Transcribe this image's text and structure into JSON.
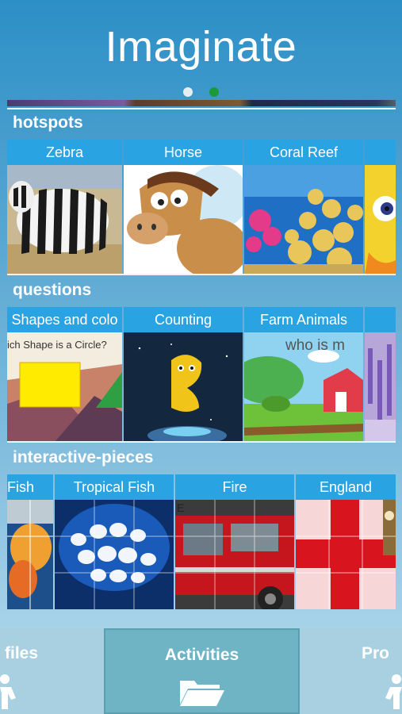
{
  "app": {
    "title": "Imaginate"
  },
  "pager": {
    "count": 2,
    "active_index": 1,
    "active_color": "#1b9a3c"
  },
  "sections": [
    {
      "label": "hotspots",
      "tiles": [
        "Zebra",
        "Horse",
        "Coral Reef",
        ""
      ]
    },
    {
      "label": "questions",
      "tiles": [
        "Shapes and colo",
        "Counting",
        "Farm Animals",
        ""
      ]
    },
    {
      "label": "interactive-pieces",
      "tiles": [
        "Fish",
        "Tropical Fish",
        "Fire",
        "England"
      ]
    }
  ],
  "tile_texts": {
    "shapes_prompt": "ich Shape is a Circle?",
    "farm_prompt": "who is m",
    "fire_bus_text": "E"
  },
  "nav": {
    "files": "files",
    "activities": "Activities",
    "profile": "Pro"
  },
  "colors": {
    "tile_header": "#2aa3e2",
    "active_tab": "#6fb4c5"
  }
}
